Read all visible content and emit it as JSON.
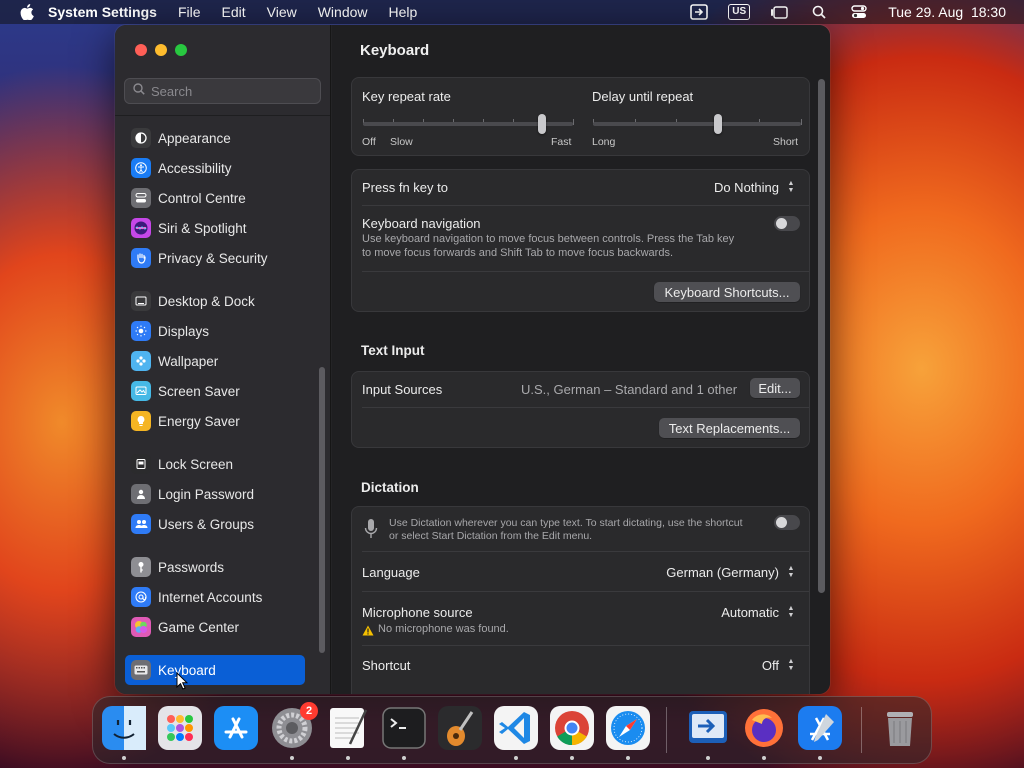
{
  "menubar": {
    "app_name": "System Settings",
    "menus": [
      "File",
      "Edit",
      "View",
      "Window",
      "Help"
    ],
    "input_source_badge": "US",
    "clock": "Tue 29. Aug  18:30"
  },
  "sidebar": {
    "search_placeholder": "Search",
    "items": [
      {
        "label": "Appearance",
        "icon": "appearance-icon",
        "color": "#3a3a3c"
      },
      {
        "label": "Accessibility",
        "icon": "accessibility-icon",
        "color": "#1a7cf5"
      },
      {
        "label": "Control Centre",
        "icon": "control-centre-icon",
        "color": "#6e6e73"
      },
      {
        "label": "Siri & Spotlight",
        "icon": "siri-icon",
        "color": "#c547e8"
      },
      {
        "label": "Privacy & Security",
        "icon": "privacy-hand-icon",
        "color": "#2f7bf6"
      },
      {
        "label": "Desktop & Dock",
        "icon": "desktop-dock-icon",
        "color": "#3a3a3c"
      },
      {
        "label": "Displays",
        "icon": "displays-icon",
        "color": "#2f7bf6"
      },
      {
        "label": "Wallpaper",
        "icon": "wallpaper-icon",
        "color": "#4fb4f0"
      },
      {
        "label": "Screen Saver",
        "icon": "screen-saver-icon",
        "color": "#46b9e6"
      },
      {
        "label": "Energy Saver",
        "icon": "energy-saver-icon",
        "color": "#f5b523"
      },
      {
        "label": "Lock Screen",
        "icon": "lock-screen-icon",
        "color": "#2b2b2d"
      },
      {
        "label": "Login Password",
        "icon": "login-password-icon",
        "color": "#6e6e73"
      },
      {
        "label": "Users & Groups",
        "icon": "users-groups-icon",
        "color": "#2f7bf6"
      },
      {
        "label": "Passwords",
        "icon": "passwords-key-icon",
        "color": "#8e8e93"
      },
      {
        "label": "Internet Accounts",
        "icon": "internet-accounts-icon",
        "color": "#2f7bf6"
      },
      {
        "label": "Game Center",
        "icon": "game-center-icon",
        "color": "#e05ab6"
      },
      {
        "label": "Keyboard",
        "icon": "keyboard-icon",
        "color": "#6e6e73",
        "selected": true
      }
    ]
  },
  "content": {
    "title": "Keyboard",
    "key_repeat": {
      "label": "Key repeat rate",
      "left1": "Off",
      "left2": "Slow",
      "right": "Fast",
      "value_fraction": 0.85
    },
    "delay_repeat": {
      "label": "Delay until repeat",
      "left": "Long",
      "right": "Short",
      "value_fraction": 0.6
    },
    "fn_key": {
      "label": "Press fn key to",
      "value": "Do Nothing"
    },
    "keyboard_navigation": {
      "label": "Keyboard navigation",
      "desc1": "Use keyboard navigation to move focus between controls. Press the Tab key",
      "desc2": "to move focus forwards and Shift Tab to move focus backwards.",
      "enabled": false
    },
    "keyboard_shortcuts_button": "Keyboard Shortcuts...",
    "text_input": {
      "heading": "Text Input",
      "input_sources_label": "Input Sources",
      "input_sources_value": "U.S., German – Standard and 1 other",
      "edit_button": "Edit...",
      "text_replacements_button": "Text Replacements..."
    },
    "dictation": {
      "heading": "Dictation",
      "desc1": "Use Dictation wherever you can type text. To start dictating, use the shortcut",
      "desc2": "or select Start Dictation from the Edit menu.",
      "enabled": false,
      "language_label": "Language",
      "language_value": "German (Germany)",
      "mic_label": "Microphone source",
      "mic_value": "Automatic",
      "mic_warning": "No microphone was found.",
      "shortcut_label": "Shortcut",
      "shortcut_value": "Off"
    }
  },
  "dock": {
    "apps": [
      {
        "name": "finder-icon",
        "color": "#2a8cf0"
      },
      {
        "name": "launchpad-icon",
        "color": "#d8d8dc"
      },
      {
        "name": "app-store-icon",
        "color": "#1c8ef5"
      },
      {
        "name": "system-settings-icon",
        "color": "#7c7c80"
      },
      {
        "name": "textedit-icon",
        "color": "#f2f2f2"
      },
      {
        "name": "terminal-icon",
        "color": "#1d1d1f"
      },
      {
        "name": "garageband-icon",
        "color": "#3a3a3c"
      },
      {
        "name": "vscode-icon",
        "color": "#f4f4f4"
      },
      {
        "name": "chrome-icon",
        "color": "#f4f4f4"
      },
      {
        "name": "safari-icon",
        "color": "#f4f4f4"
      },
      {
        "name": "migration-assistant-icon",
        "color": "#1c5fb8"
      },
      {
        "name": "firefox-icon",
        "color": "#ff7139"
      },
      {
        "name": "xcode-icon",
        "color": "#1c7cf0"
      },
      {
        "name": "trash-icon",
        "color": "#8e8e93"
      }
    ],
    "settings_badge": "2"
  }
}
